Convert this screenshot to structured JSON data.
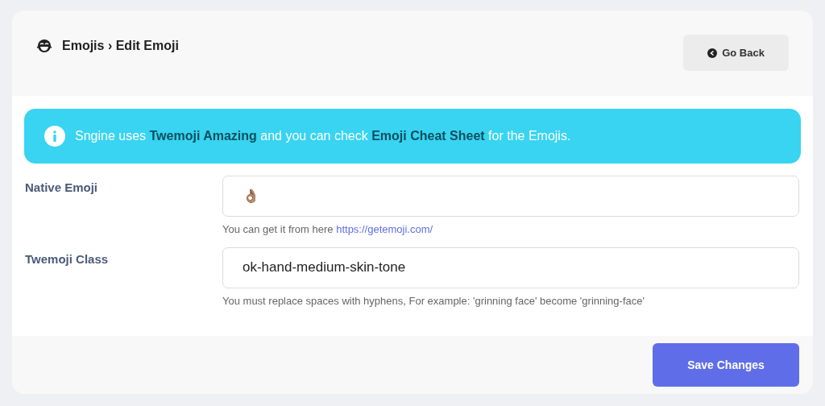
{
  "header": {
    "breadcrumb": "Emojis › Edit Emoji",
    "back_button": "Go Back"
  },
  "alert": {
    "text": "Sngine uses **Twemoji Amazing** and you can check **Emoji Cheat Sheet** for the Emojis."
  },
  "fields": [
    {
      "label": "Native Emoji",
      "value": "👌🏽",
      "help": "You can get it from here",
      "help_link": "https://getemoji.com/"
    },
    {
      "label": "Twemoji Class",
      "value": "ok-hand-medium-skin-tone",
      "help": "You must replace spaces with hyphens, For example: 'grinning face' become 'grinning-face'"
    }
  ],
  "footer": {
    "save_button": "Save Changes"
  }
}
